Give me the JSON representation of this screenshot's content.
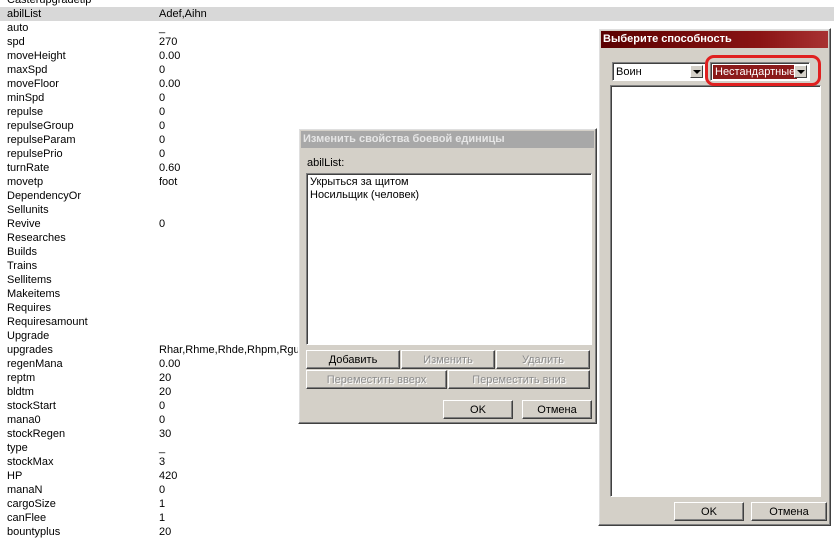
{
  "grid": {
    "rows": [
      {
        "key": "Casterupgradetip",
        "value": ""
      },
      {
        "key": "abilList",
        "value": "Adef,Aihn",
        "selected": true
      },
      {
        "key": "auto",
        "value": "_"
      },
      {
        "key": "spd",
        "value": "270"
      },
      {
        "key": "moveHeight",
        "value": "0.00"
      },
      {
        "key": "maxSpd",
        "value": "0"
      },
      {
        "key": "moveFloor",
        "value": "0.00"
      },
      {
        "key": "minSpd",
        "value": "0"
      },
      {
        "key": "repulse",
        "value": "0"
      },
      {
        "key": "repulseGroup",
        "value": "0"
      },
      {
        "key": "repulseParam",
        "value": "0"
      },
      {
        "key": "repulsePrio",
        "value": "0"
      },
      {
        "key": "turnRate",
        "value": "0.60"
      },
      {
        "key": "movetp",
        "value": "foot"
      },
      {
        "key": "DependencyOr",
        "value": ""
      },
      {
        "key": "Sellunits",
        "value": ""
      },
      {
        "key": "Revive",
        "value": "0"
      },
      {
        "key": "Researches",
        "value": ""
      },
      {
        "key": "Builds",
        "value": ""
      },
      {
        "key": "Trains",
        "value": ""
      },
      {
        "key": "Sellitems",
        "value": ""
      },
      {
        "key": "Makeitems",
        "value": ""
      },
      {
        "key": "Requires",
        "value": ""
      },
      {
        "key": "Requiresamount",
        "value": ""
      },
      {
        "key": "Upgrade",
        "value": ""
      },
      {
        "key": "upgrades",
        "value": "Rhar,Rhme,Rhde,Rhpm,Rguv"
      },
      {
        "key": "regenMana",
        "value": "0.00"
      },
      {
        "key": "reptm",
        "value": "20"
      },
      {
        "key": "bldtm",
        "value": "20"
      },
      {
        "key": "stockStart",
        "value": "0"
      },
      {
        "key": "mana0",
        "value": "0"
      },
      {
        "key": "stockRegen",
        "value": "30"
      },
      {
        "key": "type",
        "value": "_"
      },
      {
        "key": "stockMax",
        "value": "3"
      },
      {
        "key": "HP",
        "value": "420"
      },
      {
        "key": "manaN",
        "value": "0"
      },
      {
        "key": "cargoSize",
        "value": "1"
      },
      {
        "key": "canFlee",
        "value": "1"
      },
      {
        "key": "bountyplus",
        "value": "20"
      }
    ]
  },
  "edit_dialog": {
    "title": "Изменить свойства боевой единицы",
    "field_label": "abilList:",
    "items": [
      "Укрыться за щитом",
      "Носильщик (человек)"
    ],
    "add_label": "Добавить",
    "change_label": "Изменить",
    "delete_label": "Удалить",
    "move_up_label": "Переместить вверх",
    "move_down_label": "Переместить вниз",
    "ok_label": "OK",
    "cancel_label": "Отмена"
  },
  "pick_dialog": {
    "title": "Выберите способность",
    "unit_combo": "Воин",
    "type_combo": "Нестандартные",
    "ok_label": "OK",
    "cancel_label": "Отмена"
  },
  "colors": {
    "active_title": "#8a1414",
    "inactive_title": "#a8a8a8",
    "highlight": "#e02020",
    "selected_combo": "#8b1a1a"
  }
}
